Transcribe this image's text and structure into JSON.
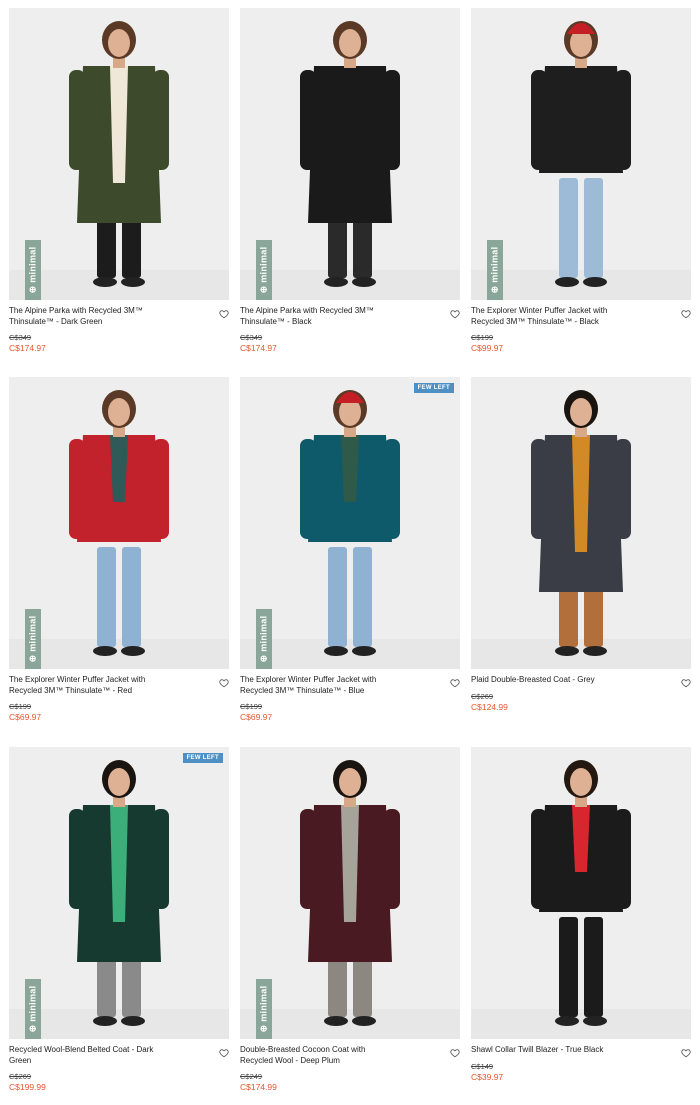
{
  "brand_badge": "minimal",
  "products": [
    {
      "name": "The Alpine Parka with Recycled 3M™ Thinsulate™ - Dark Green",
      "old_price": "C$349",
      "new_price": "C$174.97",
      "badge": "minimal",
      "few_left": "",
      "coat_color": "#3d4a2c",
      "top_color": "#efe8d8",
      "pants_color": "#1c1c1c",
      "hair": "#5a3a26",
      "hat": ""
    },
    {
      "name": "The Alpine Parka with Recycled 3M™ Thinsulate™ - Black",
      "old_price": "C$349",
      "new_price": "C$174.97",
      "badge": "minimal",
      "few_left": "",
      "coat_color": "#1a1a1a",
      "top_color": "#1a1a1a",
      "pants_color": "#2a2a2a",
      "hair": "#5a3a26",
      "hat": ""
    },
    {
      "name": "The Explorer Winter Puffer Jacket with Recycled 3M™ Thinsulate™ - Black",
      "old_price": "C$199",
      "new_price": "C$99.97",
      "badge": "minimal",
      "few_left": "",
      "coat_color": "#1e1e1e",
      "top_color": "#1e1e1e",
      "pants_color": "#9dbbd6",
      "hair": "#5a3a26",
      "hat": "#c41f25"
    },
    {
      "name": "The Explorer Winter Puffer Jacket with Recycled 3M™ Thinsulate™ - Red",
      "old_price": "C$199",
      "new_price": "C$69.97",
      "badge": "minimal",
      "few_left": "",
      "coat_color": "#c1222b",
      "top_color": "#2f5a58",
      "pants_color": "#8fb2d2",
      "hair": "#5a3a26",
      "hat": ""
    },
    {
      "name": "The Explorer Winter Puffer Jacket with Recycled 3M™ Thinsulate™ - Blue",
      "old_price": "C$199",
      "new_price": "C$69.97",
      "badge": "minimal",
      "few_left": "FEW LEFT",
      "coat_color": "#0f5a6a",
      "top_color": "#2f5a4a",
      "pants_color": "#8fb2d2",
      "hair": "#5a3a26",
      "hat": "#c41f25"
    },
    {
      "name": "Plaid Double-Breasted Coat - Grey",
      "old_price": "C$269",
      "new_price": "C$124.99",
      "badge": "",
      "few_left": "",
      "coat_color": "#3a3d45",
      "top_color": "#d28a27",
      "pants_color": "#b36f3b",
      "hair": "#1a1410",
      "hat": ""
    },
    {
      "name": "Recycled Wool-Blend Belted Coat - Dark Green",
      "old_price": "C$269",
      "new_price": "C$199.99",
      "badge": "minimal",
      "few_left": "FEW LEFT",
      "coat_color": "#163a30",
      "top_color": "#3cae7a",
      "pants_color": "#8a8a8a",
      "hair": "#1a1410",
      "hat": ""
    },
    {
      "name": "Double-Breasted Cocoon Coat with Recycled Wool - Deep Plum",
      "old_price": "C$249",
      "new_price": "C$174.99",
      "badge": "minimal",
      "few_left": "",
      "coat_color": "#4a1a22",
      "top_color": "#a6a39a",
      "pants_color": "#8c8780",
      "hair": "#1a1410",
      "hat": ""
    },
    {
      "name": "Shawl Collar Twill Blazer - True Black",
      "old_price": "C$149",
      "new_price": "C$39.97",
      "badge": "",
      "few_left": "",
      "coat_color": "#1b1b1b",
      "top_color": "#d8262e",
      "pants_color": "#1b1b1b",
      "hair": "#241810",
      "hat": ""
    }
  ]
}
